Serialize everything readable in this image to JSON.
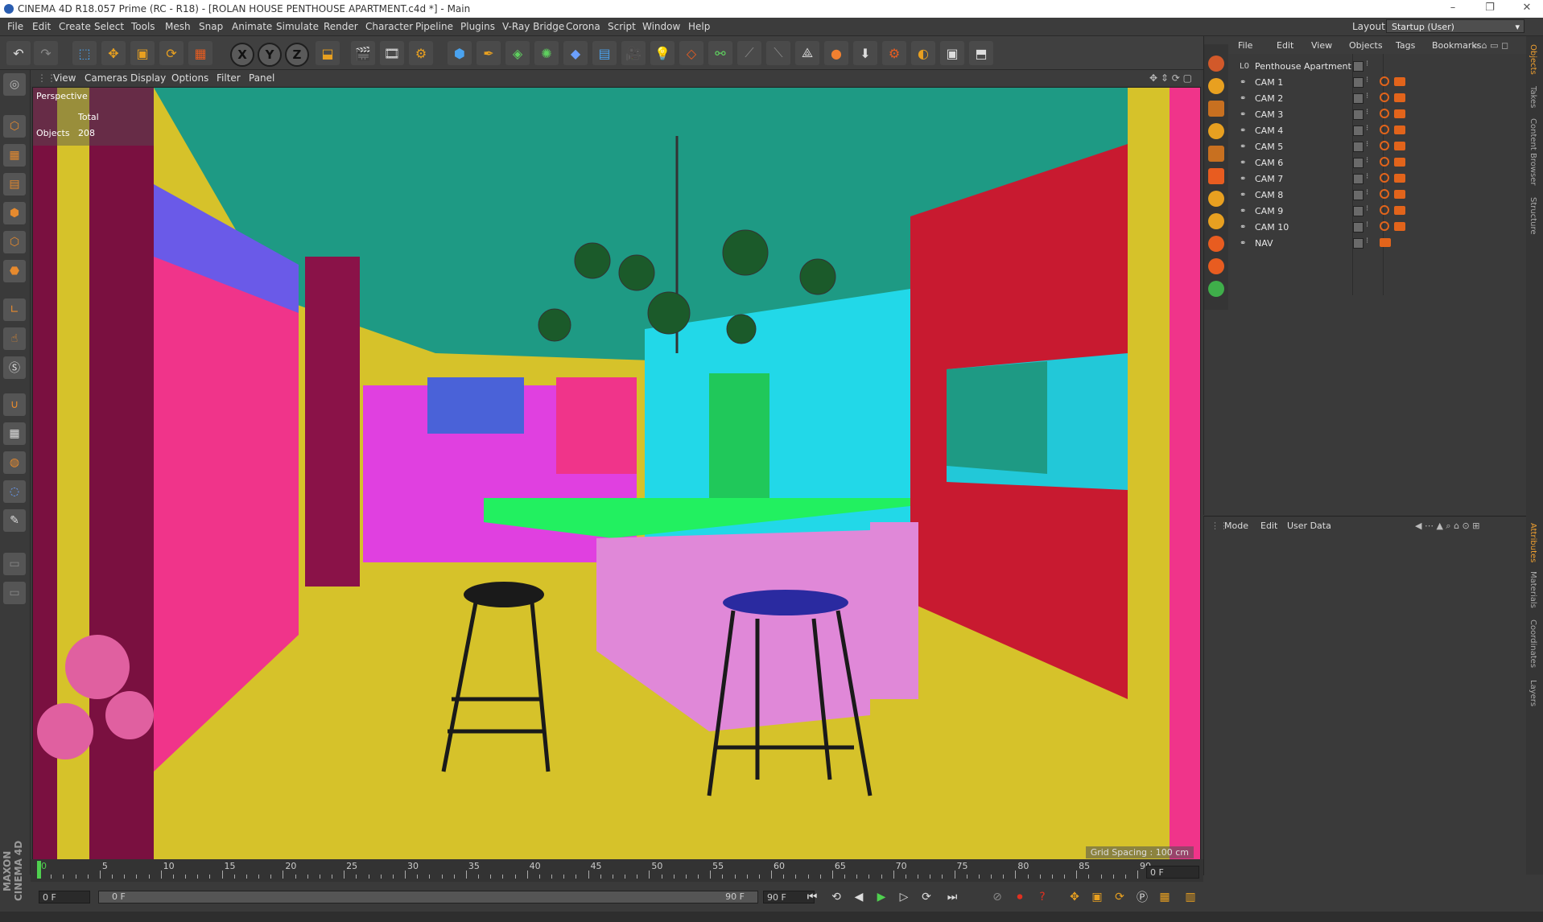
{
  "window": {
    "title": "CINEMA 4D R18.057 Prime (RC - R18) - [ROLAN HOUSE PENTHOUSE APARTMENT.c4d *] - Main",
    "controls": {
      "minimize": "–",
      "restore": "❐",
      "close": "✕"
    }
  },
  "menubar": {
    "items": [
      "File",
      "Edit",
      "Create",
      "Select",
      "Tools",
      "Mesh",
      "Snap",
      "Animate",
      "Simulate",
      "Render",
      "Character",
      "Pipeline",
      "Plugins",
      "V-Ray Bridge",
      "Corona",
      "Script",
      "Window",
      "Help"
    ],
    "layout_label": "Layout:",
    "layout_value": "Startup (User)"
  },
  "toolbar": {
    "axis_x": "X",
    "axis_y": "Y",
    "axis_z": "Z"
  },
  "viewport": {
    "menu": [
      "View",
      "Cameras",
      "Display",
      "Options",
      "Filter",
      "Panel"
    ],
    "camera_name": "Perspective",
    "hud": {
      "total_label": "Total",
      "objects_label": "Objects",
      "objects_value": "208"
    },
    "grid_spacing": "Grid Spacing : 100 cm"
  },
  "object_manager": {
    "menu": [
      "File",
      "Edit",
      "View",
      "Objects",
      "Tags",
      "Bookmarks"
    ],
    "root": "Penthouse Apartment",
    "objects": [
      "CAM 1",
      "CAM 2",
      "CAM 3",
      "CAM 4",
      "CAM 5",
      "CAM 6",
      "CAM 7",
      "CAM 8",
      "CAM 9",
      "CAM 10",
      "NAV"
    ]
  },
  "attributes_manager": {
    "menu": [
      "Mode",
      "Edit",
      "User Data"
    ]
  },
  "right_tabs": {
    "top": [
      "Objects",
      "Takes",
      "Content Browser",
      "Structure"
    ],
    "bottom": [
      "Attributes",
      "Materials",
      "Coordinates",
      "Layers"
    ]
  },
  "timeline": {
    "labels": [
      "0",
      "5",
      "10",
      "15",
      "20",
      "25",
      "30",
      "35",
      "40",
      "45",
      "50",
      "55",
      "60",
      "65",
      "70",
      "75",
      "80",
      "85",
      "90"
    ],
    "current_frame": "0 F"
  },
  "transport": {
    "start_frame": "0 F",
    "range_start": "0 F",
    "range_end": "90 F",
    "end_frame": "90 F"
  },
  "branding": "MAXON CINEMA 4D",
  "colors": {
    "accent": "#e2641b",
    "viewport_floor": "#d6c22a",
    "viewport_ceiling": "#1e9a84"
  }
}
